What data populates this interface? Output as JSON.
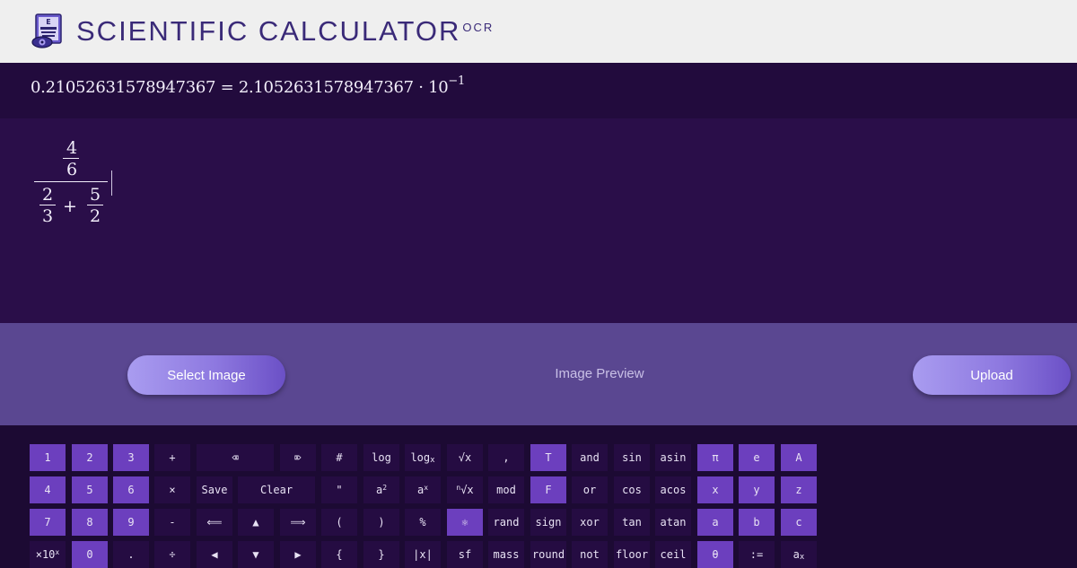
{
  "header": {
    "title": "SCIENTIFIC CALCULATOR",
    "title_sup": "OCR",
    "logo_letter": "E"
  },
  "result": {
    "lhs": "0.21052631578947367",
    "eq": "=",
    "mantissa": "2.1052631578947367",
    "dot": "·",
    "base": "10",
    "exponent": "−1"
  },
  "editor": {
    "top_num": "4",
    "top_den": "6",
    "a_num": "2",
    "a_den": "3",
    "plus": "+",
    "b_num": "5",
    "b_den": "2"
  },
  "ocr": {
    "select_label": "Select Image",
    "preview_label": "Image Preview",
    "upload_label": "Upload"
  },
  "keys": {
    "k1": "1",
    "k2": "2",
    "k3": "3",
    "plus": "+",
    "backspace": "⌫",
    "delete": "⌦",
    "hash": "#",
    "log": "log",
    "logx_base": "log",
    "logx_sub": "x",
    "sqrt": "√x",
    "comma": ",",
    "true": "T",
    "and": "and",
    "sin": "sin",
    "asin": "asin",
    "pi": "π",
    "e": "e",
    "A": "A",
    "k4": "4",
    "k5": "5",
    "k6": "6",
    "times": "×",
    "save": "Save",
    "clear": "Clear",
    "quote": "\"",
    "sq_base": "a",
    "sq_sup": "2",
    "pow_base": "a",
    "pow_sup": "x",
    "nroot_sup": "n",
    "nroot_base": "√x",
    "mod": "mod",
    "false": "F",
    "or": "or",
    "cos": "cos",
    "acos": "acos",
    "x": "x",
    "y": "y",
    "z": "z",
    "k7": "7",
    "k8": "8",
    "k9": "9",
    "minus": "-",
    "left_arrow": "⟸",
    "up": "▲",
    "right_arrow": "⟹",
    "lparen": "(",
    "rparen": ")",
    "percent": "%",
    "atom": "⚛",
    "rand": "rand",
    "sign": "sign",
    "xor": "xor",
    "tan": "tan",
    "atan": "atan",
    "a": "a",
    "b": "b",
    "c": "c",
    "sci_base": "×10",
    "sci_sup": "x",
    "k0": "0",
    "dot": ".",
    "divide": "÷",
    "left": "◀",
    "down": "▼",
    "right": "▶",
    "lbrace": "{",
    "rbrace": "}",
    "abs": "|x|",
    "sf": "sf",
    "mass": "mass",
    "round": "round",
    "not": "not",
    "floor": "floor",
    "ceil": "ceil",
    "theta": "θ",
    "assign": ":=",
    "sub_base": "a",
    "sub_sub": "x"
  },
  "colors": {
    "header_bg": "#efefef",
    "title": "#3a2a78",
    "result_bg": "#220b3d",
    "editor_bg": "#2a0e49",
    "ocr_bg": "#5a4791",
    "key_purple": "#6c3fbe",
    "key_dark": "#250c42"
  },
  "icons": {
    "logo": "eye-chart-icon"
  }
}
